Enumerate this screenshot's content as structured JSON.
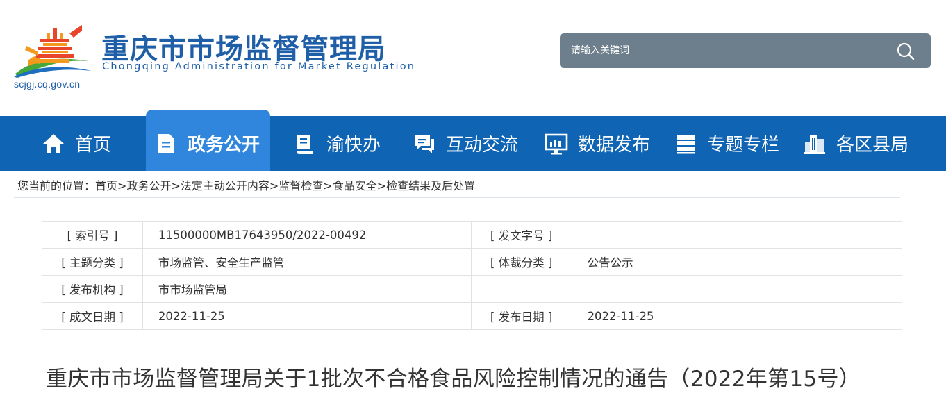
{
  "header": {
    "title": "重庆市市场监督管理局",
    "subtitle": "Chongqing  Administration  for  Market  Regulation",
    "url": "scjgj.cq.gov.cn",
    "logo_icon": "tiananmen-emblem-icon"
  },
  "search": {
    "placeholder": "请输入关键词",
    "icon": "search-icon"
  },
  "nav": {
    "items": [
      {
        "label": "首页",
        "icon": "home-icon"
      },
      {
        "label": "政务公开",
        "icon": "document-icon",
        "active": true
      },
      {
        "label": "渝快办",
        "icon": "book-icon"
      },
      {
        "label": "互动交流",
        "icon": "chat-icon"
      },
      {
        "label": "数据发布",
        "icon": "monitor-chart-icon"
      },
      {
        "label": "专题专栏",
        "icon": "stack-icon"
      },
      {
        "label": "各区县局",
        "icon": "building-icon"
      }
    ]
  },
  "breadcrumb": {
    "prefix": "您当前的位置：",
    "items": [
      "首页",
      "政务公开",
      "法定主动公开内容",
      "监督检查",
      "食品安全",
      "检查结果及后处置"
    ],
    "separator": ">"
  },
  "info": {
    "rows": [
      {
        "label1": "[ 索引号 ]",
        "value1": "11500000MB17643950/2022-00492",
        "label2": "[ 发文字号 ]",
        "value2": ""
      },
      {
        "label1": "[ 主题分类 ]",
        "value1": "市场监管、安全生产监管",
        "label2": "[ 体裁分类 ]",
        "value2": "公告公示"
      },
      {
        "label1": "[ 发布机构 ]",
        "value1": "市市场监管局",
        "label2": "",
        "value2": ""
      },
      {
        "label1": "[ 成文日期 ]",
        "value1": "2022-11-25",
        "label2": "[ 发布日期 ]",
        "value2": "2022-11-25"
      }
    ]
  },
  "article": {
    "title": "重庆市市场监督管理局关于1批次不合格食品风险控制情况的通告（2022年第15号）"
  },
  "colors": {
    "brand_blue": "#1f5fa8",
    "nav_bg": "#0f64b4",
    "nav_active": "#2f86dc",
    "search_bg": "#6d7f8c"
  }
}
